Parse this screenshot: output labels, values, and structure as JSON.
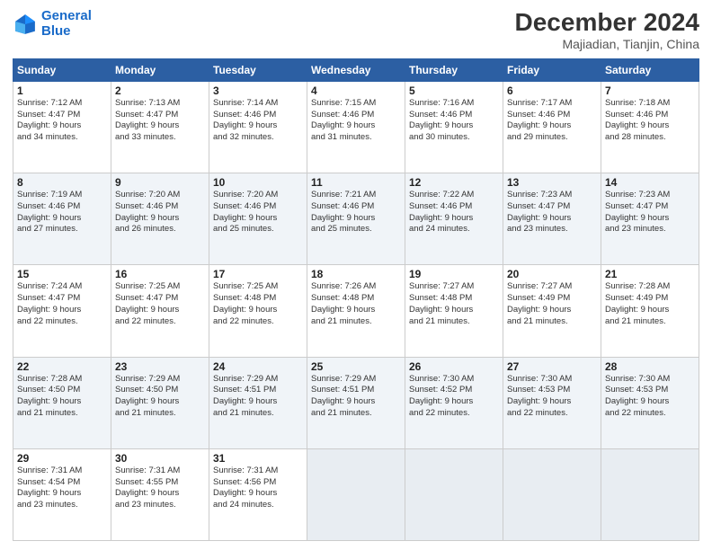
{
  "header": {
    "logo_line1": "General",
    "logo_line2": "Blue",
    "main_title": "December 2024",
    "subtitle": "Majiadian, Tianjin, China"
  },
  "days_of_week": [
    "Sunday",
    "Monday",
    "Tuesday",
    "Wednesday",
    "Thursday",
    "Friday",
    "Saturday"
  ],
  "weeks": [
    [
      {
        "day": "1",
        "info": "Sunrise: 7:12 AM\nSunset: 4:47 PM\nDaylight: 9 hours\nand 34 minutes."
      },
      {
        "day": "2",
        "info": "Sunrise: 7:13 AM\nSunset: 4:47 PM\nDaylight: 9 hours\nand 33 minutes."
      },
      {
        "day": "3",
        "info": "Sunrise: 7:14 AM\nSunset: 4:46 PM\nDaylight: 9 hours\nand 32 minutes."
      },
      {
        "day": "4",
        "info": "Sunrise: 7:15 AM\nSunset: 4:46 PM\nDaylight: 9 hours\nand 31 minutes."
      },
      {
        "day": "5",
        "info": "Sunrise: 7:16 AM\nSunset: 4:46 PM\nDaylight: 9 hours\nand 30 minutes."
      },
      {
        "day": "6",
        "info": "Sunrise: 7:17 AM\nSunset: 4:46 PM\nDaylight: 9 hours\nand 29 minutes."
      },
      {
        "day": "7",
        "info": "Sunrise: 7:18 AM\nSunset: 4:46 PM\nDaylight: 9 hours\nand 28 minutes."
      }
    ],
    [
      {
        "day": "8",
        "info": "Sunrise: 7:19 AM\nSunset: 4:46 PM\nDaylight: 9 hours\nand 27 minutes."
      },
      {
        "day": "9",
        "info": "Sunrise: 7:20 AM\nSunset: 4:46 PM\nDaylight: 9 hours\nand 26 minutes."
      },
      {
        "day": "10",
        "info": "Sunrise: 7:20 AM\nSunset: 4:46 PM\nDaylight: 9 hours\nand 25 minutes."
      },
      {
        "day": "11",
        "info": "Sunrise: 7:21 AM\nSunset: 4:46 PM\nDaylight: 9 hours\nand 25 minutes."
      },
      {
        "day": "12",
        "info": "Sunrise: 7:22 AM\nSunset: 4:46 PM\nDaylight: 9 hours\nand 24 minutes."
      },
      {
        "day": "13",
        "info": "Sunrise: 7:23 AM\nSunset: 4:47 PM\nDaylight: 9 hours\nand 23 minutes."
      },
      {
        "day": "14",
        "info": "Sunrise: 7:23 AM\nSunset: 4:47 PM\nDaylight: 9 hours\nand 23 minutes."
      }
    ],
    [
      {
        "day": "15",
        "info": "Sunrise: 7:24 AM\nSunset: 4:47 PM\nDaylight: 9 hours\nand 22 minutes."
      },
      {
        "day": "16",
        "info": "Sunrise: 7:25 AM\nSunset: 4:47 PM\nDaylight: 9 hours\nand 22 minutes."
      },
      {
        "day": "17",
        "info": "Sunrise: 7:25 AM\nSunset: 4:48 PM\nDaylight: 9 hours\nand 22 minutes."
      },
      {
        "day": "18",
        "info": "Sunrise: 7:26 AM\nSunset: 4:48 PM\nDaylight: 9 hours\nand 21 minutes."
      },
      {
        "day": "19",
        "info": "Sunrise: 7:27 AM\nSunset: 4:48 PM\nDaylight: 9 hours\nand 21 minutes."
      },
      {
        "day": "20",
        "info": "Sunrise: 7:27 AM\nSunset: 4:49 PM\nDaylight: 9 hours\nand 21 minutes."
      },
      {
        "day": "21",
        "info": "Sunrise: 7:28 AM\nSunset: 4:49 PM\nDaylight: 9 hours\nand 21 minutes."
      }
    ],
    [
      {
        "day": "22",
        "info": "Sunrise: 7:28 AM\nSunset: 4:50 PM\nDaylight: 9 hours\nand 21 minutes."
      },
      {
        "day": "23",
        "info": "Sunrise: 7:29 AM\nSunset: 4:50 PM\nDaylight: 9 hours\nand 21 minutes."
      },
      {
        "day": "24",
        "info": "Sunrise: 7:29 AM\nSunset: 4:51 PM\nDaylight: 9 hours\nand 21 minutes."
      },
      {
        "day": "25",
        "info": "Sunrise: 7:29 AM\nSunset: 4:51 PM\nDaylight: 9 hours\nand 21 minutes."
      },
      {
        "day": "26",
        "info": "Sunrise: 7:30 AM\nSunset: 4:52 PM\nDaylight: 9 hours\nand 22 minutes."
      },
      {
        "day": "27",
        "info": "Sunrise: 7:30 AM\nSunset: 4:53 PM\nDaylight: 9 hours\nand 22 minutes."
      },
      {
        "day": "28",
        "info": "Sunrise: 7:30 AM\nSunset: 4:53 PM\nDaylight: 9 hours\nand 22 minutes."
      }
    ],
    [
      {
        "day": "29",
        "info": "Sunrise: 7:31 AM\nSunset: 4:54 PM\nDaylight: 9 hours\nand 23 minutes."
      },
      {
        "day": "30",
        "info": "Sunrise: 7:31 AM\nSunset: 4:55 PM\nDaylight: 9 hours\nand 23 minutes."
      },
      {
        "day": "31",
        "info": "Sunrise: 7:31 AM\nSunset: 4:56 PM\nDaylight: 9 hours\nand 24 minutes."
      },
      {
        "day": "",
        "info": ""
      },
      {
        "day": "",
        "info": ""
      },
      {
        "day": "",
        "info": ""
      },
      {
        "day": "",
        "info": ""
      }
    ]
  ]
}
